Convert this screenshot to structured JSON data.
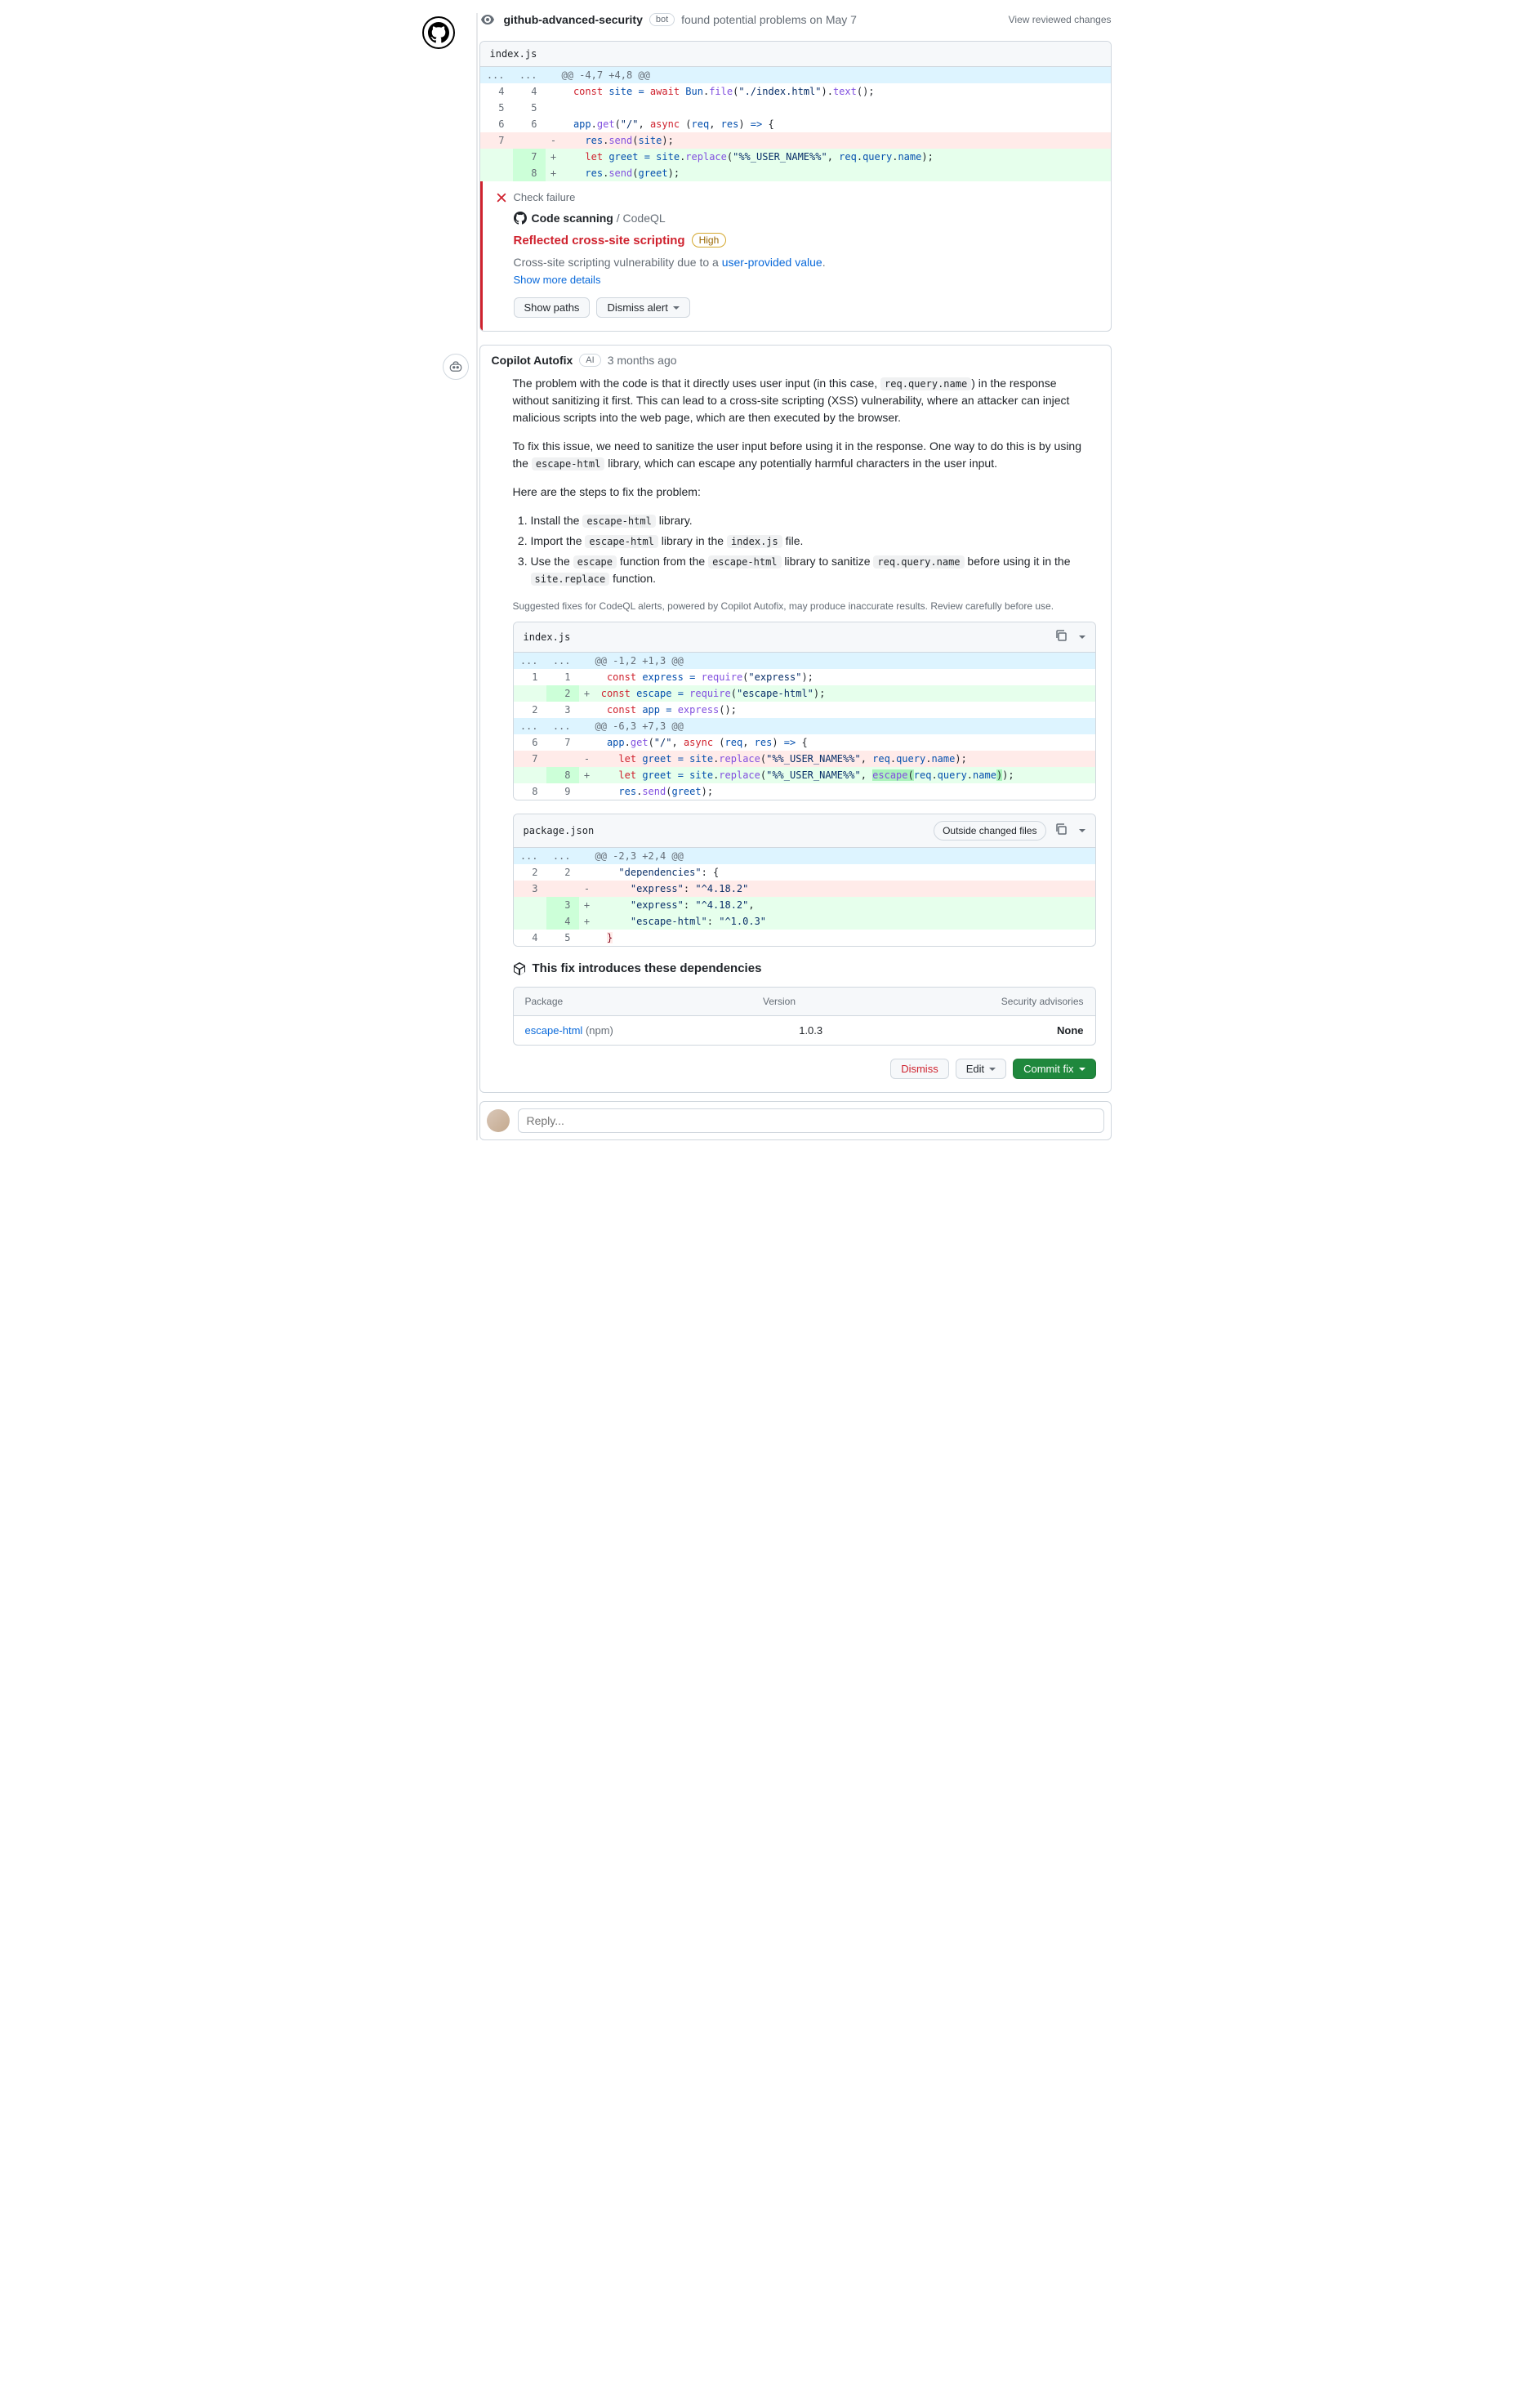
{
  "header": {
    "actor": "github-advanced-security",
    "badge": "bot",
    "action": "found potential problems on May 7",
    "review_link": "View reviewed changes"
  },
  "diff1": {
    "filename": "index.js",
    "hunk": "@@ -4,7 +4,8 @@"
  },
  "alert": {
    "check_failure": "Check failure",
    "scanning": "Code scanning",
    "tool": "/ CodeQL",
    "title": "Reflected cross-site scripting",
    "severity": "High",
    "desc_pre": "Cross-site scripting vulnerability due to a ",
    "desc_link": "user-provided value",
    "more": "Show more details",
    "show_paths": "Show paths",
    "dismiss": "Dismiss alert"
  },
  "autofix": {
    "name": "Copilot Autofix",
    "badge": "AI",
    "time": "3 months ago",
    "p1a": "The problem with the code is that it directly uses user input (in this case, ",
    "p1code": "req.query.name",
    "p1b": ") in the response without sanitizing it first. This can lead to a cross-site scripting (XSS) vulnerability, where an attacker can inject malicious scripts into the web page, which are then executed by the browser.",
    "p2a": "To fix this issue, we need to sanitize the user input before using it in the response. One way to do this is by using the ",
    "p2code": "escape-html",
    "p2b": " library, which can escape any potentially harmful characters in the user input.",
    "p3": "Here are the steps to fix the problem:",
    "li1a": "Install the ",
    "li1code": "escape-html",
    "li1b": " library.",
    "li2a": "Import the ",
    "li2code": "escape-html",
    "li2b": " library in the ",
    "li2code2": "index.js",
    "li2c": " file.",
    "li3a": "Use the ",
    "li3code": "escape",
    "li3b": " function from the ",
    "li3code2": "escape-html",
    "li3c": " library to sanitize ",
    "li3code3": "req.query.name",
    "li3d": " before using it in the ",
    "li3code4": "site.replace",
    "li3e": " function.",
    "note": "Suggested fixes for CodeQL alerts, powered by Copilot Autofix, may produce inaccurate results. Review carefully before use."
  },
  "diff2": {
    "filename": "index.js",
    "hunk1": "@@ -1,2 +1,3 @@",
    "hunk2": "@@ -6,3 +7,3 @@"
  },
  "diff3": {
    "filename": "package.json",
    "chip": "Outside changed files",
    "hunk": "@@ -2,3 +2,4 @@"
  },
  "deps": {
    "title": "This fix introduces these dependencies",
    "h_pkg": "Package",
    "h_ver": "Version",
    "h_sec": "Security advisories",
    "pkg": "escape-html",
    "registry": "(npm)",
    "ver": "1.0.3",
    "sec": "None"
  },
  "actions": {
    "dismiss": "Dismiss",
    "edit": "Edit",
    "commit": "Commit fix"
  },
  "reply": {
    "placeholder": "Reply..."
  }
}
